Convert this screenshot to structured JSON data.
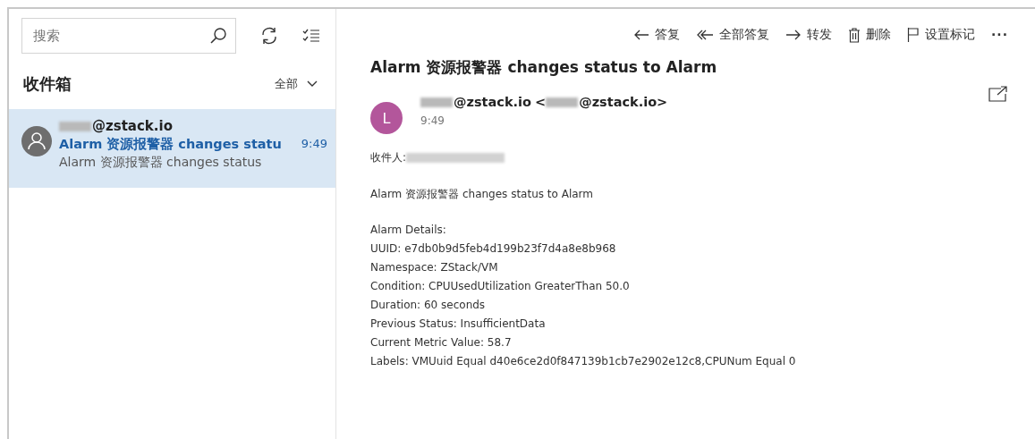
{
  "search": {
    "placeholder": "搜索"
  },
  "folder": {
    "title": "收件箱",
    "filter": "全部"
  },
  "messages": [
    {
      "sender": "@zstack.io",
      "sender_redacted": true,
      "subject": "Alarm 资源报警器 changes statu",
      "time": "9:49",
      "preview": "Alarm 资源报警器 changes status",
      "selected": true
    }
  ],
  "toolbar": [
    {
      "kind": "reply",
      "label": "答复"
    },
    {
      "kind": "reply-all",
      "label": "全部答复"
    },
    {
      "kind": "forward",
      "label": "转发"
    },
    {
      "kind": "delete",
      "label": "删除"
    },
    {
      "kind": "flag",
      "label": "设置标记"
    },
    {
      "kind": "more",
      "label": "···"
    }
  ],
  "email": {
    "subject": "Alarm 资源报警器 changes status to Alarm",
    "avatar_letter": "L",
    "from": "@zstack.io",
    "from_redacted": true,
    "from_address": "@zstack.io>",
    "address_redacted": true,
    "address_open": "<",
    "time": "9:49",
    "to_label": "收件人:",
    "to_redacted": true,
    "body": [
      "Alarm 资源报警器 changes status to Alarm"
    ],
    "details": [
      "Alarm Details:",
      "UUID: e7db0b9d5feb4d199b23f7d4a8e8b968",
      "Namespace: ZStack/VM",
      "Condition: CPUUsedUtilization GreaterThan 50.0",
      "Duration: 60 seconds",
      "Previous Status: InsufficientData",
      "Current Metric Value: 58.7",
      "Labels: VMUuid Equal d40e6ce2d0f847139b1cb7e2902e12c8,CPUNum Equal 0"
    ]
  }
}
